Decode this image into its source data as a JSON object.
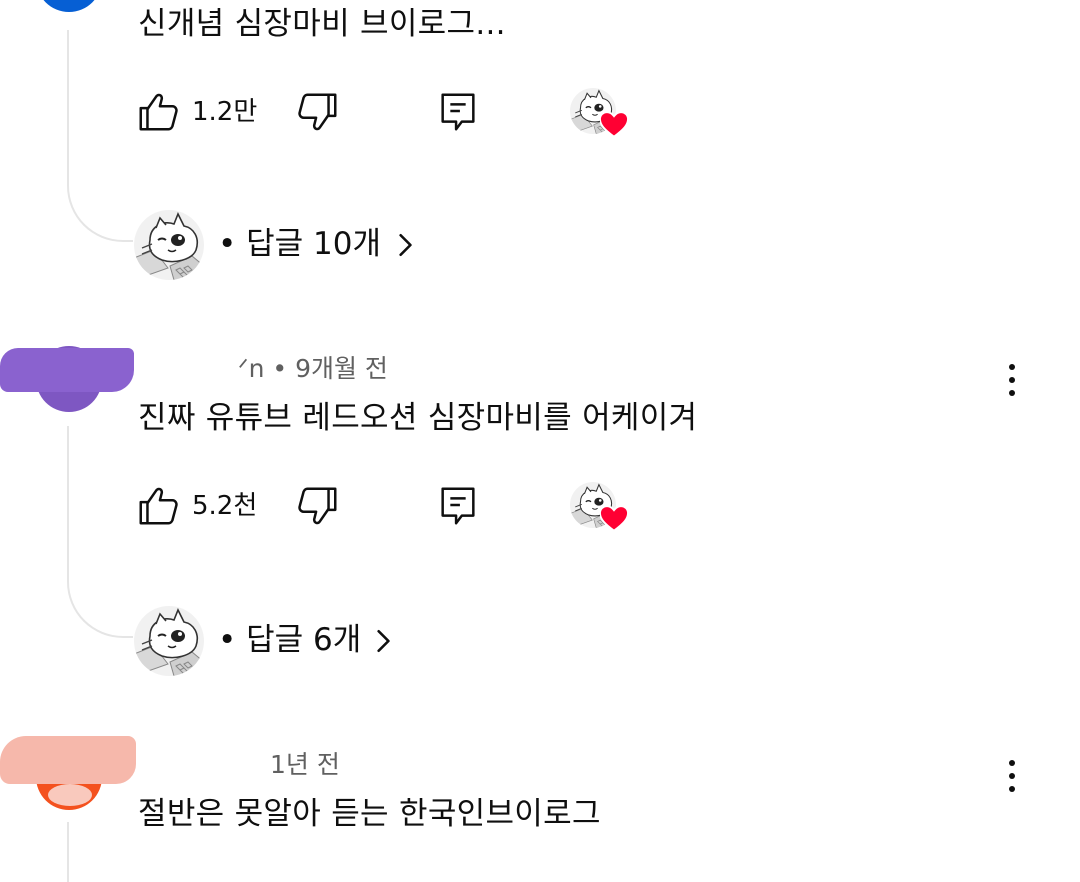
{
  "comments": [
    {
      "text": "신개념 심장마비 브이로그...",
      "meta": "",
      "likes": "1.2만",
      "replies_label": "• 답글 10개",
      "avatar_color": "#065fd4"
    },
    {
      "text": "진짜 유튜브 레드오션 심장마비를 어케이겨",
      "meta": "ᐟn • 9개월 전",
      "likes": "5.2천",
      "replies_label": "• 답글 6개",
      "avatar_color": "#7e57c2"
    },
    {
      "text": "절반은 못알아 듣는 한국인브이로그",
      "meta": "1년 전",
      "avatar_color": "#f4511e"
    }
  ],
  "icons": {
    "like": "thumbs-up-icon",
    "dislike": "thumbs-down-icon",
    "reply": "reply-comment-icon",
    "creator_heart": "creator-heart-icon",
    "more": "more-vertical-icon",
    "chevron": "chevron-right-icon"
  },
  "colors": {
    "heart": "#ff0033",
    "meta_text": "#606060",
    "thread_line": "#e5e5e5"
  }
}
